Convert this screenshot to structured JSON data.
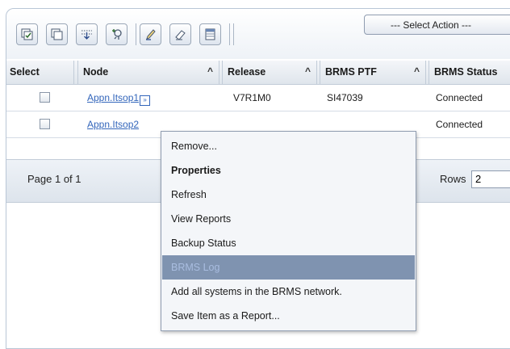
{
  "toolbar": {
    "select_action": "--- Select Action ---",
    "icons": [
      "select-all-icon",
      "deselect-all-icon",
      "expand-all-icon",
      "find-icon",
      "edit-sort-icon",
      "clear-sort-icon",
      "table-options-icon"
    ]
  },
  "table": {
    "headers": {
      "select": "Select",
      "node": "Node",
      "release": "Release",
      "brms_ptf": "BRMS PTF",
      "brms_status": "BRMS Status",
      "sort_glyph": "^"
    },
    "rows": [
      {
        "node": "Appn.Itsop1",
        "release": "V7R1M0",
        "brms_ptf": "SI47039",
        "brms_status": "Connected"
      },
      {
        "node": "Appn.Itsop2",
        "release": "",
        "brms_ptf": "",
        "brms_status": "Connected"
      }
    ],
    "row_menu_glyph": "»"
  },
  "pager": {
    "page_info": "Page 1 of 1",
    "rows_label": "Rows",
    "rows_value": "2"
  },
  "context_menu": {
    "items": [
      {
        "label": "Remove...",
        "bold": false,
        "highlighted": false
      },
      {
        "label": "Properties",
        "bold": true,
        "highlighted": false
      },
      {
        "label": "Refresh",
        "bold": false,
        "highlighted": false
      },
      {
        "label": "View Reports",
        "bold": false,
        "highlighted": false
      },
      {
        "label": "Backup Status",
        "bold": false,
        "highlighted": false
      },
      {
        "label": "BRMS Log",
        "bold": false,
        "highlighted": true
      },
      {
        "label": "Add all systems in the BRMS network.",
        "bold": false,
        "highlighted": false
      },
      {
        "label": "Save Item as a Report...",
        "bold": false,
        "highlighted": false
      }
    ]
  },
  "colors": {
    "link": "#3366bb",
    "menu_highlight": "#7f93b0",
    "border": "#b9c6d6"
  }
}
